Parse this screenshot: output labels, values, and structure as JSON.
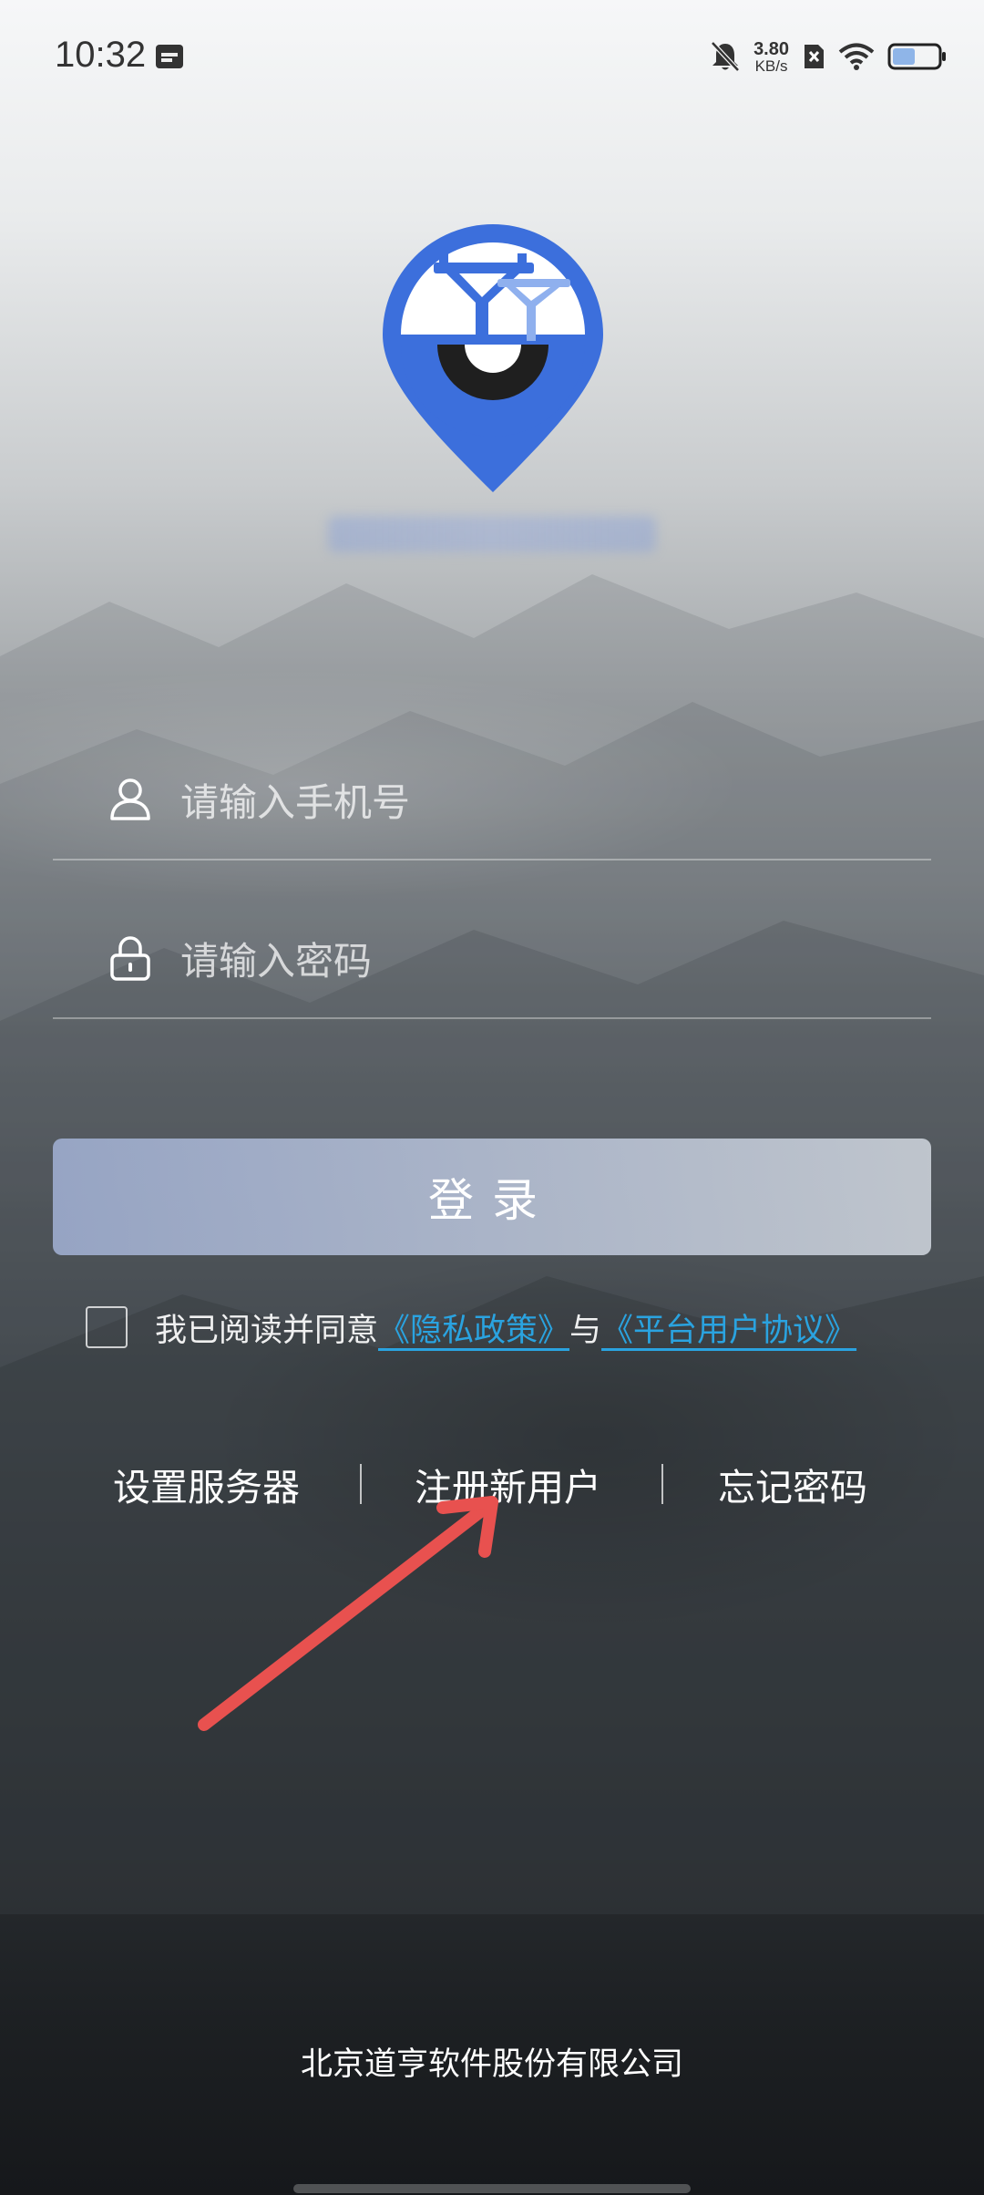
{
  "status_bar": {
    "time": "10:32",
    "net_speed_value": "3.80",
    "net_speed_unit": "KB/s",
    "icons": [
      "calendar-icon",
      "bell-muted-icon",
      "sim-x-icon",
      "wifi-icon",
      "battery-icon"
    ]
  },
  "logo": {
    "icon": "location-pin-logo",
    "colors": {
      "primary": "#3c6fdc",
      "light": "#8fb0ee",
      "dark": "#1f1f1f"
    }
  },
  "form": {
    "phone": {
      "placeholder": "请输入手机号",
      "value": "",
      "icon": "user-icon"
    },
    "password": {
      "placeholder": "请输入密码",
      "value": "",
      "icon": "lock-icon"
    },
    "login_label": "登录"
  },
  "agreement": {
    "checked": false,
    "prefix": "我已阅读并同意",
    "privacy_link": "《隐私政策》",
    "conjunction": "与",
    "terms_link": "《平台用户协议》",
    "link_color": "#2aa3e0"
  },
  "links": {
    "server_settings": "设置服务器",
    "register": "注册新用户",
    "forgot_password": "忘记密码"
  },
  "annotation": {
    "arrow_color": "#e8514f"
  },
  "footer": {
    "company": "北京道亨软件股份有限公司"
  }
}
